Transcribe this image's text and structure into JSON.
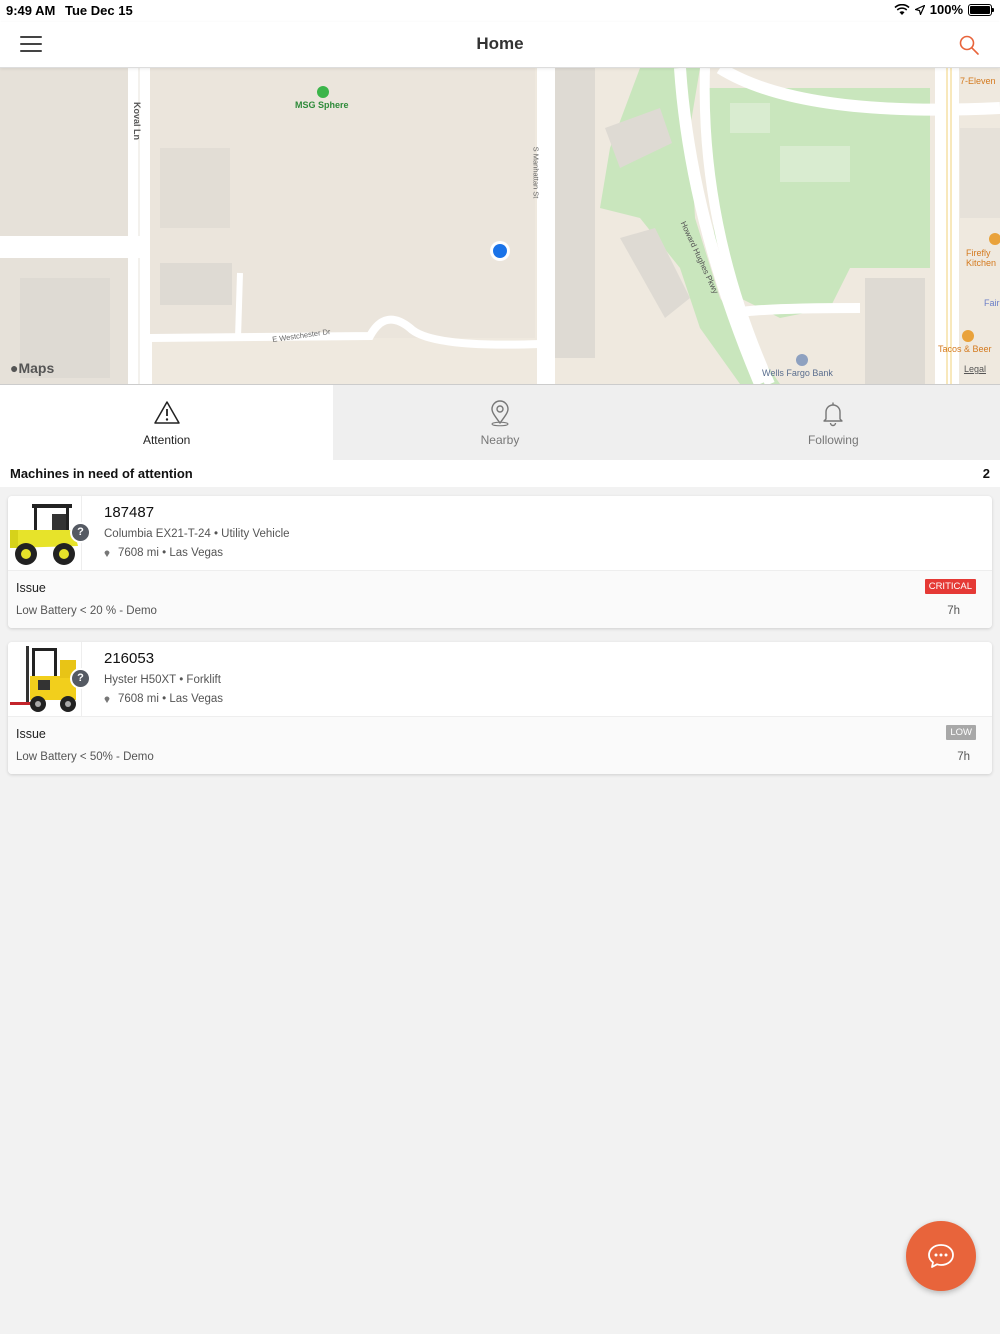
{
  "status_bar": {
    "time": "9:49 AM",
    "date": "Tue Dec 15",
    "battery": "100%"
  },
  "header": {
    "title": "Home"
  },
  "map": {
    "labels": {
      "msg_sphere": "MSG Sphere",
      "koval_ln": "Koval Ln",
      "s_manhattan_st": "S Manhattan St",
      "howard_hughes_pkwy": "Howard Hughes Pkwy",
      "e_westchester_dr": "E Westchester Dr",
      "seven_eleven": "7-Eleven",
      "firefly": "Firefly Kitchen",
      "fair": "Fair",
      "tacos_beer": "Tacos & Beer",
      "wells_fargo": "Wells Fargo Bank"
    },
    "logo": "Maps",
    "legal": "Legal"
  },
  "tabs": [
    {
      "label": "Attention",
      "icon": "warning-icon",
      "active": true
    },
    {
      "label": "Nearby",
      "icon": "location-pin-icon",
      "active": false
    },
    {
      "label": "Following",
      "icon": "bell-icon",
      "active": false
    }
  ],
  "section": {
    "title": "Machines in need of attention",
    "count": "2"
  },
  "machines": [
    {
      "id": "187487",
      "model": "Columbia EX21-T-24 • Utility Vehicle",
      "location": "7608 mi • Las Vegas",
      "issue_label": "Issue",
      "issue_desc": "Low Battery < 20 % - Demo",
      "severity": "CRITICAL",
      "severity_color": "#e53935",
      "age": "7h"
    },
    {
      "id": "216053",
      "model": "Hyster H50XT • Forklift",
      "location": "7608 mi • Las Vegas",
      "issue_label": "Issue",
      "issue_desc": "Low Battery < 50% - Demo",
      "severity": "LOW",
      "severity_color": "#a8a8a8",
      "age": "7h"
    }
  ],
  "colors": {
    "accent": "#e8643b",
    "map_bg": "#efe9df",
    "park": "#c9e6bd",
    "location_dot": "#1a73e8"
  }
}
